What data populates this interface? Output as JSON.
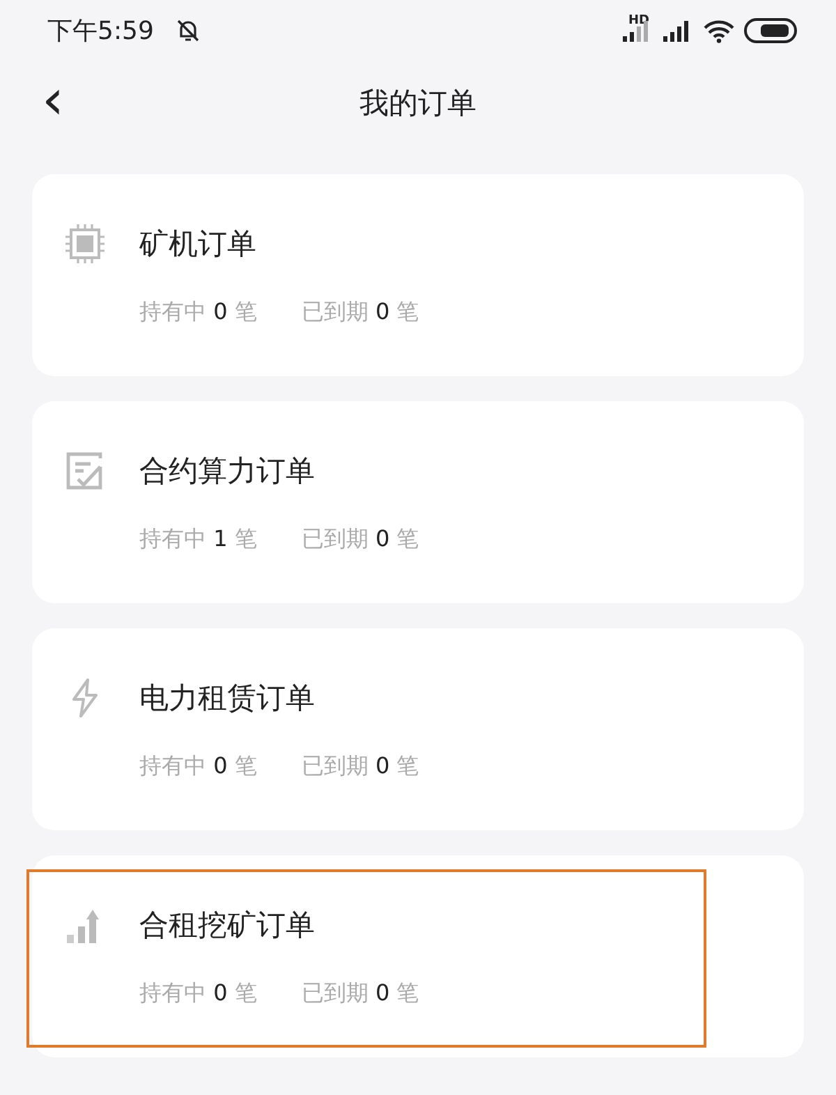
{
  "status_bar": {
    "time": "下午5:59",
    "hd_label": "HD"
  },
  "header": {
    "back": "‹",
    "title": "我的订单"
  },
  "orders": [
    {
      "kind": "chip",
      "title": "矿机订单",
      "highlighted": false,
      "stats": [
        {
          "label": "持有中",
          "count": "0",
          "unit": "笔"
        },
        {
          "label": "已到期",
          "count": "0",
          "unit": "笔"
        }
      ]
    },
    {
      "kind": "contract",
      "title": "合约算力订单",
      "highlighted": false,
      "stats": [
        {
          "label": "持有中",
          "count": "1",
          "unit": "笔"
        },
        {
          "label": "已到期",
          "count": "0",
          "unit": "笔"
        }
      ]
    },
    {
      "kind": "bolt",
      "title": "电力租赁订单",
      "highlighted": false,
      "stats": [
        {
          "label": "持有中",
          "count": "0",
          "unit": "笔"
        },
        {
          "label": "已到期",
          "count": "0",
          "unit": "笔"
        }
      ]
    },
    {
      "kind": "chart",
      "title": "合租挖矿订单",
      "highlighted": true,
      "stats": [
        {
          "label": "持有中",
          "count": "0",
          "unit": "笔"
        },
        {
          "label": "已到期",
          "count": "0",
          "unit": "笔"
        }
      ]
    }
  ]
}
